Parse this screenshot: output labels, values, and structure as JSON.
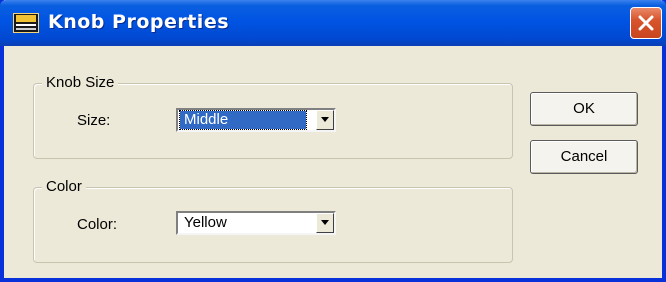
{
  "window": {
    "title": "Knob Properties",
    "icon": "app-logo-icon",
    "close_icon": "close-icon"
  },
  "knob_size_group": {
    "label": "Knob Size",
    "size_label": "Size:",
    "size_value": "Middle"
  },
  "color_group": {
    "label": "Color",
    "color_label": "Color:",
    "color_value": "Yellow"
  },
  "buttons": {
    "ok": "OK",
    "cancel": "Cancel"
  },
  "colors": {
    "titlebar": "#0054e3",
    "dialog_bg": "#ece9d8",
    "selection": "#316ac5",
    "close_button": "#d8542c"
  }
}
